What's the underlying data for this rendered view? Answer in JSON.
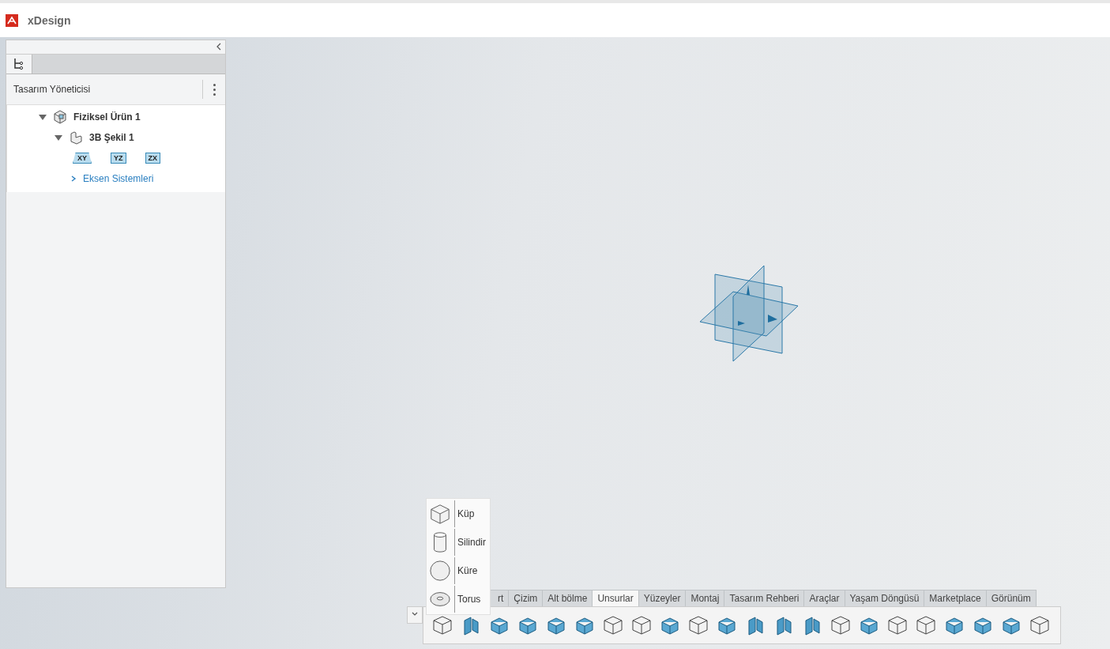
{
  "app": {
    "title": "xDesign"
  },
  "panel": {
    "title": "Tasarım Yöneticisi"
  },
  "tree": [
    {
      "label": "Fiziksel Ürün 1",
      "kind": "product",
      "expanded": true,
      "children": [
        {
          "label": "3B Şekil 1",
          "kind": "part",
          "expanded": true,
          "children": [
            {
              "kind": "planes",
              "planes": [
                "XY",
                "YZ",
                "ZX"
              ]
            },
            {
              "label": "Eksen Sistemleri",
              "kind": "folder",
              "expanded": false
            }
          ]
        }
      ]
    }
  ],
  "shape_menu": [
    {
      "label": "Küp",
      "kind": "cube"
    },
    {
      "label": "Silindir",
      "kind": "cylinder"
    },
    {
      "label": "Küre",
      "kind": "sphere"
    },
    {
      "label": "Torus",
      "kind": "torus"
    }
  ],
  "command_tabs": [
    {
      "label": "rt",
      "selected": false
    },
    {
      "label": "Çizim",
      "selected": false
    },
    {
      "label": "Alt bölme",
      "selected": false
    },
    {
      "label": "Unsurlar",
      "selected": true
    },
    {
      "label": "Yüzeyler",
      "selected": false
    },
    {
      "label": "Montaj",
      "selected": false
    },
    {
      "label": "Tasarım Rehberi",
      "selected": false
    },
    {
      "label": "Araçlar",
      "selected": false
    },
    {
      "label": "Yaşam Döngüsü",
      "selected": false
    },
    {
      "label": "Marketplace",
      "selected": false
    },
    {
      "label": "Görünüm",
      "selected": false
    }
  ]
}
